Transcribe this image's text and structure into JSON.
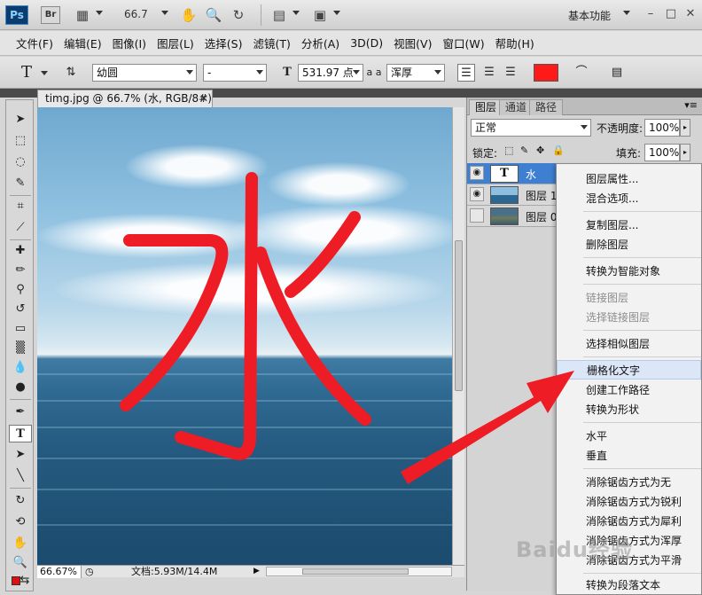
{
  "app": {
    "logo": "Ps",
    "bridge_logo": "Br",
    "zoom": "66.7",
    "workspace": "基本功能",
    "window_controls": [
      "minimize-icon",
      "maximize-icon",
      "close-icon"
    ]
  },
  "menu": [
    "文件(F)",
    "编辑(E)",
    "图像(I)",
    "图层(L)",
    "选择(S)",
    "滤镜(T)",
    "分析(A)",
    "3D(D)",
    "视图(V)",
    "窗口(W)",
    "帮助(H)"
  ],
  "options": {
    "tool_glyph": "T",
    "font_family": "幼圆",
    "font_style": "-",
    "font_size": "531.97 点",
    "aa_label": "a a",
    "aa_mode": "浑厚",
    "color": "#ff1a1a"
  },
  "document": {
    "tab_title": "timg.jpg @ 66.7% (水, RGB/8#) *",
    "zoom": "66.67%",
    "doc_info": "文档:5.93M/14.4M",
    "text": "水",
    "text_color": "#ee1c24"
  },
  "layers": {
    "tabs": [
      "图层",
      "通道",
      "路径"
    ],
    "blend_mode": "正常",
    "opacity_label": "不透明度:",
    "opacity": "100%",
    "lock_label": "锁定:",
    "fill_label": "填充:",
    "fill": "100%",
    "rows": [
      {
        "name": "水",
        "type": "text",
        "selected": true
      },
      {
        "name": "图层 1",
        "type": "image",
        "selected": false
      },
      {
        "name": "图层 0",
        "type": "image",
        "selected": false
      }
    ]
  },
  "context_menu": {
    "items": [
      {
        "label": "图层属性...",
        "disabled": false
      },
      {
        "label": "混合选项...",
        "disabled": false
      },
      {
        "label": "复制图层...",
        "disabled": false
      },
      {
        "label": "删除图层",
        "disabled": false
      },
      {
        "label": "转换为智能对象",
        "disabled": false
      },
      {
        "label": "链接图层",
        "disabled": true
      },
      {
        "label": "选择链接图层",
        "disabled": true
      },
      {
        "label": "选择相似图层",
        "disabled": false
      },
      {
        "label": "栅格化文字",
        "disabled": false,
        "highlighted": true
      },
      {
        "label": "创建工作路径",
        "disabled": false
      },
      {
        "label": "转换为形状",
        "disabled": false
      },
      {
        "label": "水平",
        "disabled": false
      },
      {
        "label": "垂直",
        "disabled": false
      },
      {
        "label": "消除锯齿方式为无",
        "disabled": false
      },
      {
        "label": "消除锯齿方式为锐利",
        "disabled": false
      },
      {
        "label": "消除锯齿方式为犀利",
        "disabled": false
      },
      {
        "label": "消除锯齿方式为浑厚",
        "disabled": false
      },
      {
        "label": "消除锯齿方式为平滑",
        "disabled": false
      },
      {
        "label": "转换为段落文本",
        "disabled": false
      }
    ]
  },
  "annotation": {
    "arrow_color": "#ee1c24"
  },
  "watermark": "Baidu经验"
}
